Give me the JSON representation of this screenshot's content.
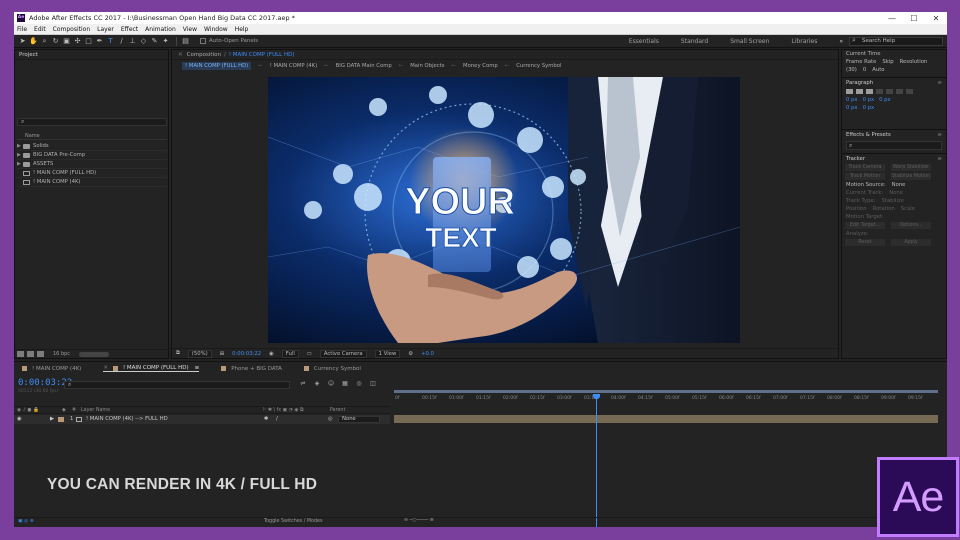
{
  "window": {
    "title": "Adobe After Effects CC 2017 - I:\\Businessman Open Hand Big Data CC 2017.aep *",
    "app_icon": "Ae",
    "controls": [
      "—",
      "☐",
      "✕"
    ]
  },
  "menu": [
    "File",
    "Edit",
    "Composition",
    "Layer",
    "Effect",
    "Animation",
    "View",
    "Window",
    "Help"
  ],
  "toolbar": {
    "auto_open_panels": "Auto-Open Panels",
    "workspaces": [
      "Essentials",
      "Standard",
      "Small Screen",
      "Libraries"
    ],
    "overflow": "»",
    "search_help": "Search Help"
  },
  "project": {
    "tab": "Project",
    "search_icon": "⌕",
    "column_name": "Name",
    "items": [
      {
        "name": "Solids",
        "type": "folder",
        "expand": "▶"
      },
      {
        "name": "BIG DATA Pre-Comp",
        "type": "folder",
        "expand": "▶"
      },
      {
        "name": "ASSETS",
        "type": "folder",
        "expand": "▶"
      },
      {
        "name": "! MAIN COMP (FULL HD)",
        "type": "comp",
        "expand": ""
      },
      {
        "name": "! MAIN COMP (4K)",
        "type": "comp",
        "expand": ""
      }
    ],
    "bpc": "16 bpc"
  },
  "composition": {
    "tab": "Composition",
    "tab_comp": "! MAIN COMP (FULL HD)",
    "breadcrumbs": [
      "! MAIN COMP (FULL HD)",
      "! MAIN COMP (4K)",
      "BIG DATA Main Comp",
      "Main Objects",
      "Money Comp",
      "Currency Symbol"
    ],
    "overlay_line1": "YOUR",
    "overlay_line2": "TEXT",
    "controls": {
      "zoom": "(50%)",
      "timecode": "0:00:03:22",
      "resolution": "Full",
      "camera": "Active Camera",
      "views": "1 View",
      "exposure": "+0.0"
    }
  },
  "right_panel": {
    "current_time": "Current Time",
    "frame_rate_label": "Frame Rate",
    "skip_label": "Skip",
    "resolution_label": "Resolution",
    "frame_rate": "(30)",
    "skip": "0",
    "resolution": "Auto",
    "paragraph": "Paragraph",
    "indent_values": [
      "0 px",
      "0 px",
      "0 px",
      "0 px",
      "0 px"
    ],
    "effects_presets": "Effects & Presets",
    "tracker": "Tracker",
    "track_camera": "Track Camera",
    "warp_stabilizer": "Warp Stabilizer",
    "track_motion": "Track Motion",
    "stabilize_motion": "Stabilize Motion",
    "motion_source_label": "Motion Source:",
    "motion_source": "None",
    "current_track_label": "Current Track:",
    "current_track": "None",
    "track_type_label": "Track Type:",
    "track_type": "Stabilize",
    "position": "Position",
    "rotation": "Rotation",
    "scale": "Scale",
    "motion_target": "Motion Target:",
    "edit_target": "Edit Target...",
    "options": "Options...",
    "analyze": "Analyze:",
    "reset": "Reset",
    "apply": "Apply"
  },
  "timeline": {
    "tabs": [
      {
        "label": "! MAIN COMP (4K)",
        "active": false,
        "color": "#b89a76"
      },
      {
        "label": "! MAIN COMP (FULL HD)",
        "active": true,
        "color": "#b89a76"
      },
      {
        "label": "Phone + BIG DATA",
        "active": false,
        "color": "#b89a76"
      },
      {
        "label": "Currency Symbol",
        "active": false,
        "color": "#b89a76"
      }
    ],
    "timecode": "0:00:03:22",
    "fps": "00112 (30.00 fps)",
    "col_layer_name": "Layer Name",
    "col_parent": "Parent",
    "layer": {
      "index": "1",
      "name": "! MAIN COMP (4K) --> FULL HD",
      "parent": "None",
      "label_color": "#b89a76"
    },
    "ruler": [
      "0f",
      "00:15f",
      "01:00f",
      "01:15f",
      "02:00f",
      "02:15f",
      "03:00f",
      "03:15f",
      "04:00f",
      "04:15f",
      "05:00f",
      "05:15f",
      "06:00f",
      "06:15f",
      "07:00f",
      "07:15f",
      "08:00f",
      "08:15f",
      "09:00f",
      "09:15f"
    ],
    "toggle_label": "Toggle Switches / Modes",
    "current_time_seconds": 3.73
  },
  "caption": "YOU CAN RENDER IN 4K / FULL HD",
  "logo": "Ae",
  "colors": {
    "accent": "#3d8df5",
    "ae_purple": "#c17cff",
    "frame": "#7a3e9d"
  }
}
